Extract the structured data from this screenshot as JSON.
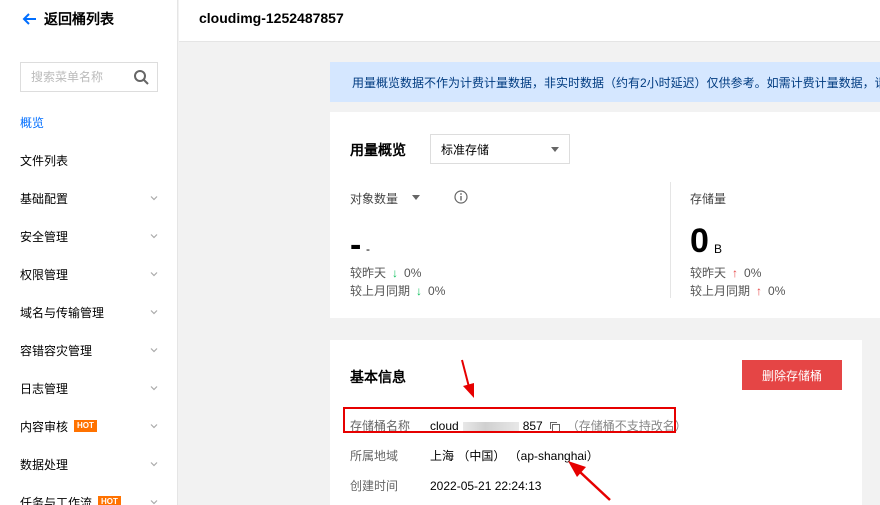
{
  "sidebar": {
    "back_label": "返回桶列表",
    "search_placeholder": "搜索菜单名称",
    "items": [
      {
        "label": "概览",
        "active": true,
        "chevron": false,
        "hot": false
      },
      {
        "label": "文件列表",
        "active": false,
        "chevron": false,
        "hot": false
      },
      {
        "label": "基础配置",
        "active": false,
        "chevron": true,
        "hot": false
      },
      {
        "label": "安全管理",
        "active": false,
        "chevron": true,
        "hot": false
      },
      {
        "label": "权限管理",
        "active": false,
        "chevron": true,
        "hot": false
      },
      {
        "label": "域名与传输管理",
        "active": false,
        "chevron": true,
        "hot": false
      },
      {
        "label": "容错容灾管理",
        "active": false,
        "chevron": true,
        "hot": false
      },
      {
        "label": "日志管理",
        "active": false,
        "chevron": true,
        "hot": false
      },
      {
        "label": "内容审核",
        "active": false,
        "chevron": true,
        "hot": true
      },
      {
        "label": "数据处理",
        "active": false,
        "chevron": true,
        "hot": false
      },
      {
        "label": "任务与工作流",
        "active": false,
        "chevron": true,
        "hot": true
      }
    ],
    "hot_badge": "HOT"
  },
  "header": {
    "bucket_name": "cloudimg-1252487857"
  },
  "notice": {
    "text": "用量概览数据不作为计费计量数据，非实时数据（约有2小时延迟）仅供参考。如需计费计量数据，请"
  },
  "overview": {
    "title": "用量概览",
    "storage_class": "标准存储",
    "objects": {
      "label": "对象数量",
      "value": "-",
      "unit": "-",
      "vs_yesterday_label": "较昨天",
      "vs_yesterday": "0%",
      "vs_last_month_label": "较上月同期",
      "vs_last_month": "0%"
    },
    "storage": {
      "label": "存储量",
      "value": "0",
      "unit": "B",
      "vs_yesterday_label": "较昨天",
      "vs_yesterday": "0%",
      "vs_last_month_label": "较上月同期",
      "vs_last_month": "0%"
    }
  },
  "basic_info": {
    "title": "基本信息",
    "delete_button": "删除存储桶",
    "name_label": "存储桶名称",
    "name_prefix": "cloud",
    "name_suffix": "857",
    "name_note": "（存储桶不支持改名）",
    "region_label": "所属地域",
    "region_value": "上海 （中国） （ap-shanghai）",
    "created_label": "创建时间",
    "created_value": "2022-05-21 22:24:13"
  },
  "colors": {
    "accent": "#006eff",
    "danger": "#e54545",
    "hot": "#ff7200",
    "notice_bg": "#d5e7ff",
    "annotation": "#e60000"
  }
}
